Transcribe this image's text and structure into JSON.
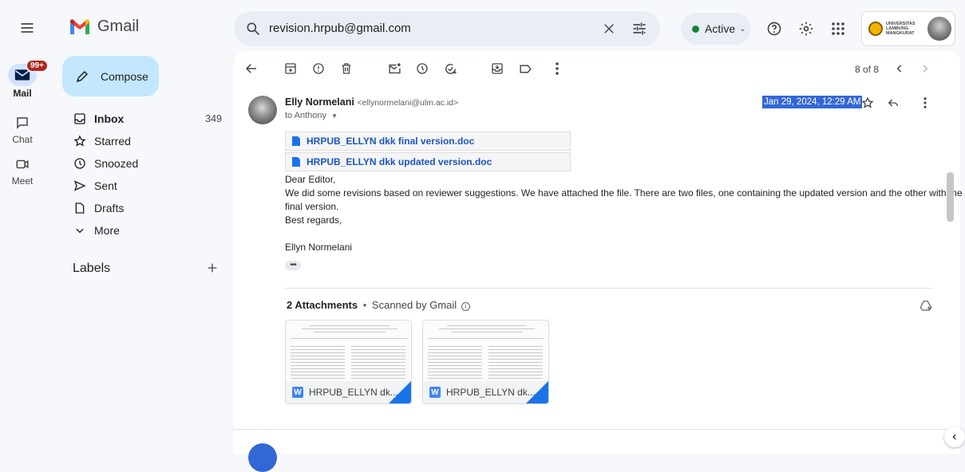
{
  "app": {
    "name": "Gmail"
  },
  "search": {
    "value": "revision.hrpub@gmail.com"
  },
  "status": {
    "label": "Active"
  },
  "account": {
    "org_label": "UNIVERSITAS LAMBUNG MANGKURAT"
  },
  "rail": {
    "mail_label": "Mail",
    "mail_badge": "99+",
    "chat_label": "Chat",
    "meet_label": "Meet"
  },
  "compose": {
    "label": "Compose"
  },
  "nav": [
    {
      "label": "Inbox",
      "count": "349",
      "icon": "inbox-icon"
    },
    {
      "label": "Starred",
      "count": "",
      "icon": "star-icon"
    },
    {
      "label": "Snoozed",
      "count": "",
      "icon": "clock-icon"
    },
    {
      "label": "Sent",
      "count": "",
      "icon": "send-icon"
    },
    {
      "label": "Drafts",
      "count": "",
      "icon": "draft-icon"
    },
    {
      "label": "More",
      "count": "",
      "icon": "chevron-down-icon"
    }
  ],
  "labels": {
    "title": "Labels"
  },
  "toolbar": {
    "pagination": "8 of 8"
  },
  "message": {
    "sender_name": "Elly Normelani",
    "sender_email": "<ellynormelani@ulm.ac.id>",
    "to": "to Anthony",
    "date": "Jan 29, 2024, 12:29 AM",
    "links": [
      "HRPUB_ELLYN dkk final version.doc",
      "HRPUB_ELLYN dkk updated version.doc"
    ],
    "greeting": "Dear Editor,",
    "body_line1": "We did some revisions based on reviewer suggestions. We have attached the file. There are two files, one containing the updated version and the other with the",
    "body_line2": "final version.",
    "closing": "Best regards,",
    "signature": "Ellyn Normelani"
  },
  "attachments": {
    "title": "2 Attachments",
    "scanned": "Scanned by Gmail",
    "items": [
      "HRPUB_ELLYN dk...",
      "HRPUB_ELLYN dk..."
    ]
  },
  "colors": {
    "accent": "#0b57d0",
    "compose_bg": "#c2e7ff",
    "active_dot": "#188038",
    "badge": "#b3261e",
    "link": "#1a55c5"
  }
}
